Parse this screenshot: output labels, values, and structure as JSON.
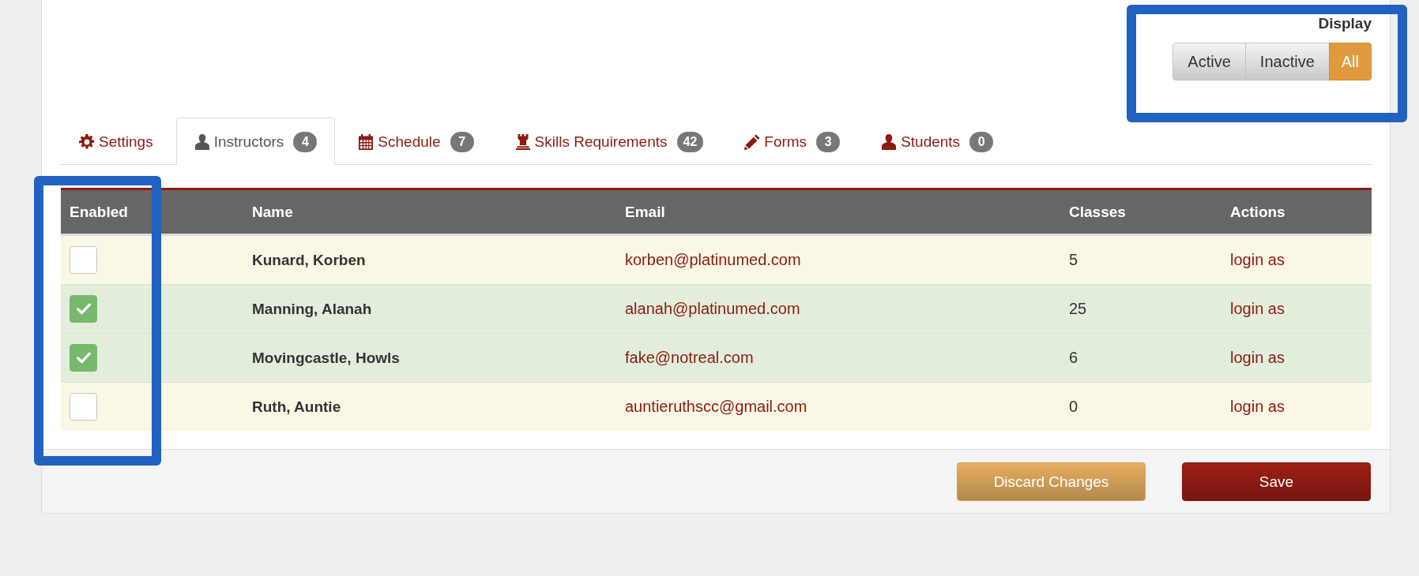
{
  "display_filter": {
    "label": "Display",
    "options": [
      {
        "label": "Active",
        "selected": false
      },
      {
        "label": "Inactive",
        "selected": false
      },
      {
        "label": "All",
        "selected": true
      }
    ]
  },
  "tabs": [
    {
      "kind": "settings",
      "label": "Settings",
      "selected": false
    },
    {
      "kind": "instructors",
      "label": "Instructors",
      "badge": "4",
      "selected": true
    },
    {
      "kind": "schedule",
      "label": "Schedule",
      "badge": "7",
      "selected": false
    },
    {
      "kind": "skills",
      "label": "Skills Requirements",
      "badge": "42",
      "selected": false
    },
    {
      "kind": "forms",
      "label": "Forms",
      "badge": "3",
      "selected": false
    },
    {
      "kind": "students",
      "label": "Students",
      "badge": "0",
      "selected": false
    }
  ],
  "table": {
    "columns": [
      "Enabled",
      "Name",
      "Email",
      "Classes",
      "Actions"
    ],
    "rows": [
      {
        "enabled": false,
        "name": "Kunard, Korben",
        "email": "korben@platinumed.com",
        "classes": "5",
        "action": "login as"
      },
      {
        "enabled": true,
        "name": "Manning, Alanah",
        "email": "alanah@platinumed.com",
        "classes": "25",
        "action": "login as"
      },
      {
        "enabled": true,
        "name": "Movingcastle, Howls",
        "email": "fake@notreal.com",
        "classes": "6",
        "action": "login as"
      },
      {
        "enabled": false,
        "name": "Ruth, Auntie",
        "email": "auntieruthscc@gmail.com",
        "classes": "0",
        "action": "login as"
      }
    ]
  },
  "footer_buttons": [
    {
      "kind": "secondary",
      "label": "Discard Changes"
    },
    {
      "kind": "primary",
      "label": "Save"
    }
  ]
}
